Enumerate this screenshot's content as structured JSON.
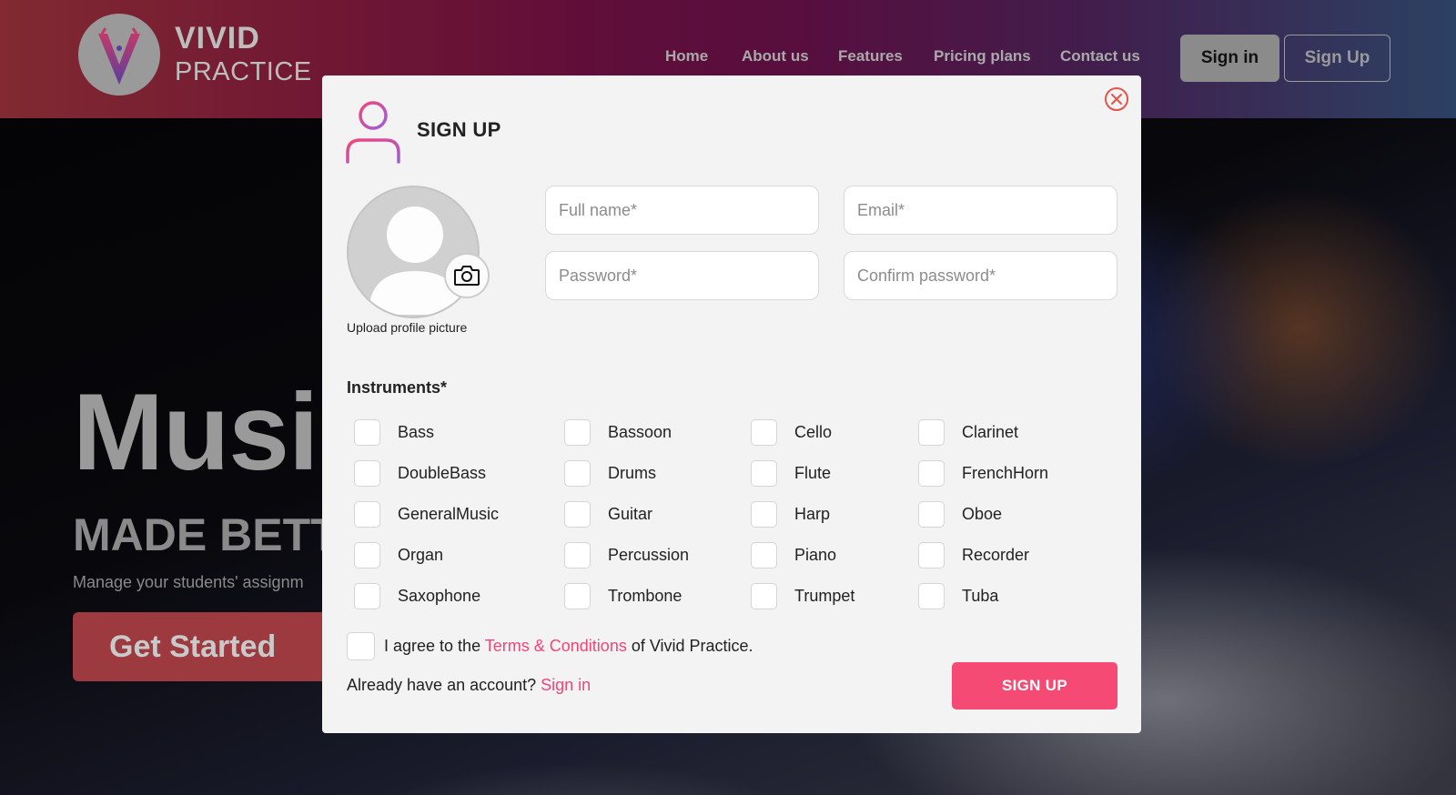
{
  "header": {
    "brand_line1": "VIVID",
    "brand_line2": "PRACTICE",
    "nav": [
      "Home",
      "About us",
      "Features",
      "Pricing plans",
      "Contact us"
    ],
    "signin_label": "Sign in",
    "signup_label": "Sign Up"
  },
  "hero": {
    "title": "Musi",
    "subtitle": "MADE BETT",
    "description": "Manage your students' assignm",
    "cta_label": "Get Started"
  },
  "modal": {
    "title": "SIGN UP",
    "upload_label": "Upload profile picture",
    "fields": {
      "full_name_placeholder": "Full name*",
      "email_placeholder": "Email*",
      "password_placeholder": "Password*",
      "confirm_placeholder": "Confirm password*"
    },
    "instruments_label": "Instruments*",
    "instruments": [
      "Bass",
      "Bassoon",
      "Cello",
      "Clarinet",
      "DoubleBass",
      "Drums",
      "Flute",
      "FrenchHorn",
      "GeneralMusic",
      "Guitar",
      "Harp",
      "Oboe",
      "Organ",
      "Percussion",
      "Piano",
      "Recorder",
      "Saxophone",
      "Trombone",
      "Trumpet",
      "Tuba"
    ],
    "agree_prefix": "I agree to the ",
    "agree_link": "Terms & Conditions",
    "agree_suffix": " of Vivid Practice.",
    "already_text": "Already have an account? ",
    "signin_link": "Sign in",
    "submit_label": "SIGN UP"
  },
  "colors": {
    "accent": "#f54a73",
    "link": "#f24677",
    "close_icon": "#e5534b"
  },
  "icons": [
    "logo-v-icon",
    "close-icon",
    "user-icon",
    "avatar-placeholder-icon",
    "camera-icon"
  ]
}
